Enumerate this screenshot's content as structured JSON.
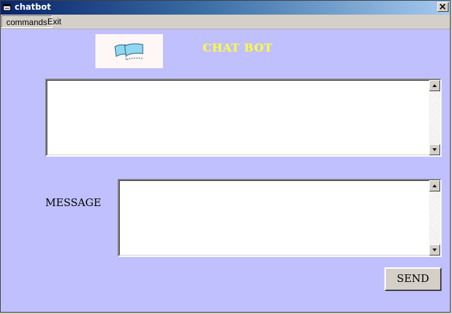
{
  "window": {
    "title": "chatbot",
    "icon": "app-window-icon",
    "close_icon": "close-icon"
  },
  "menu": {
    "items": [
      {
        "label": "commands"
      },
      {
        "label": "Exit"
      }
    ]
  },
  "logo": {
    "icon": "chat-flags-logo",
    "color": "#8fd8f0"
  },
  "heading": {
    "text": "CHAT BOT",
    "color": "#ffff33"
  },
  "conversation": {
    "value": ""
  },
  "message": {
    "label": "MESSAGE",
    "value": ""
  },
  "send_button": {
    "label": "SEND"
  },
  "colors": {
    "background": "#c0c0ff",
    "titlebar_start": "#0a246a",
    "titlebar_end": "#a6caf0"
  }
}
